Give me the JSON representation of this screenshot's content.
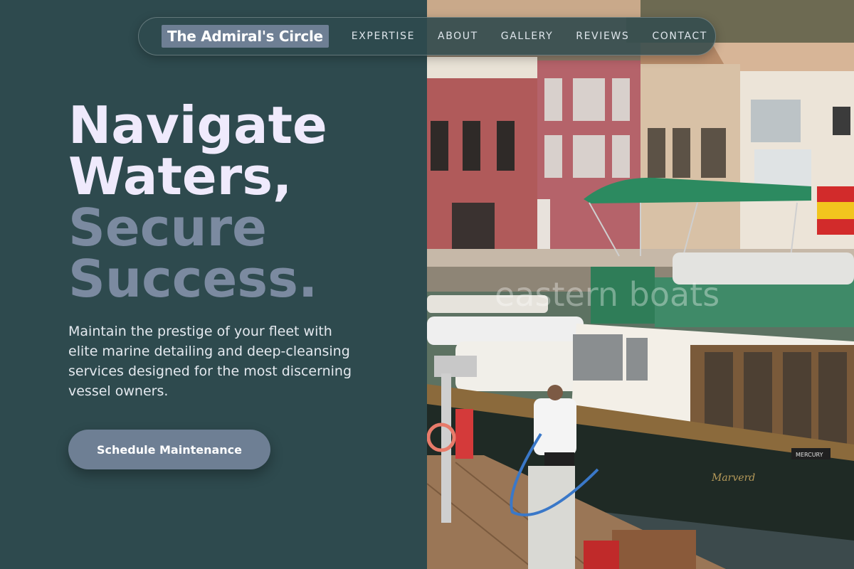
{
  "nav": {
    "brand": "The Admiral's Circle",
    "links": [
      "EXPERTISE",
      "ABOUT",
      "GALLERY",
      "REVIEWS",
      "CONTACT"
    ]
  },
  "hero": {
    "title_line1": "Navigate Waters,",
    "title_line2": "Secure Success.",
    "description": "Maintain the prestige of your fleet with elite marine detailing and deep-cleansing services designed for the most discerning vessel owners.",
    "cta_label": "Schedule Maintenance"
  },
  "photo": {
    "watermark": "eastern boats",
    "boat_name": "Marverd",
    "engine_brand": "MERCURY"
  },
  "colors": {
    "background": "#2e4a4e",
    "accent": "#6e7f94",
    "title_light": "#efeafc",
    "title_muted": "#7b8aa0"
  }
}
